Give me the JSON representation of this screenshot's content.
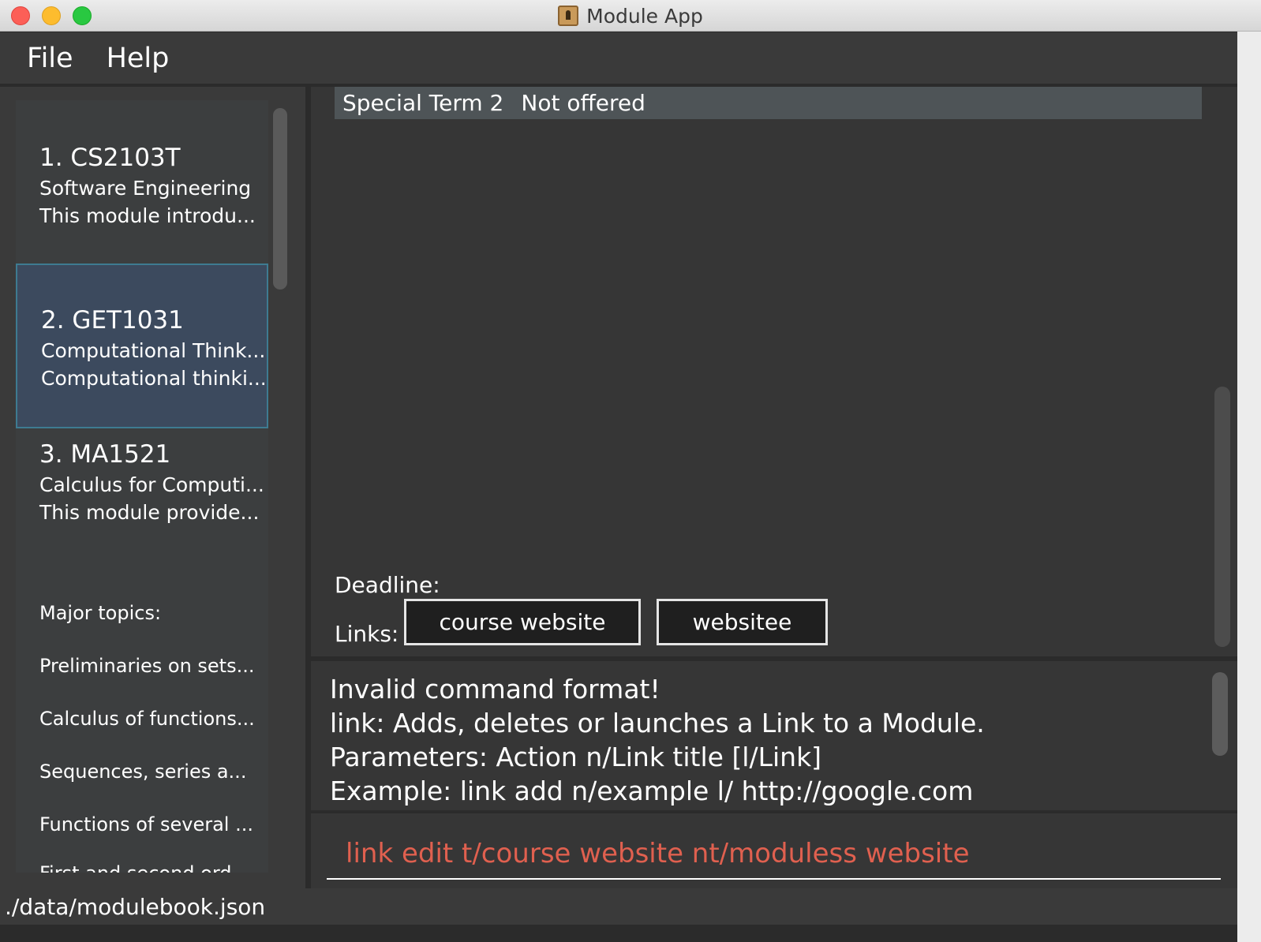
{
  "window": {
    "title": "Module App"
  },
  "menu": {
    "items": [
      "File",
      "Help"
    ]
  },
  "modules": [
    {
      "title": "1.  CS2103T",
      "line1": "Software Engineering",
      "line2": "This module introdu..."
    },
    {
      "title": "2.  GET1031",
      "line1": "Computational Think...",
      "line2": "Computational thinki..."
    },
    {
      "title": "3.  MA1521",
      "line1": "Calculus for Computi...",
      "line2": "This module provide..."
    }
  ],
  "topics": {
    "heading": "Major topics:",
    "items": [
      "Preliminaries on sets...",
      "Calculus of functions...",
      "Sequences, series a...",
      "Functions of several ...",
      "First and second ord..."
    ]
  },
  "details": {
    "term": "Special Term 2",
    "term_status": "Not offered",
    "deadline_label": "Deadline:",
    "links_label": "Links:",
    "links": [
      "course website",
      "websitee"
    ]
  },
  "result": {
    "lines": [
      "Invalid command format!",
      "link: Adds, deletes or launches a Link to a Module.",
      "Parameters: Action n/Link title [l/Link]",
      "Example: link add n/example l/ http://google.com"
    ]
  },
  "command": {
    "value": "link edit t/course website nt/moduless website"
  },
  "status": {
    "path": "./data/modulebook.json"
  },
  "colors": {
    "selected_card": "#3c4a5e",
    "selected_border": "#3e7b91",
    "command_text": "#e0604f"
  }
}
